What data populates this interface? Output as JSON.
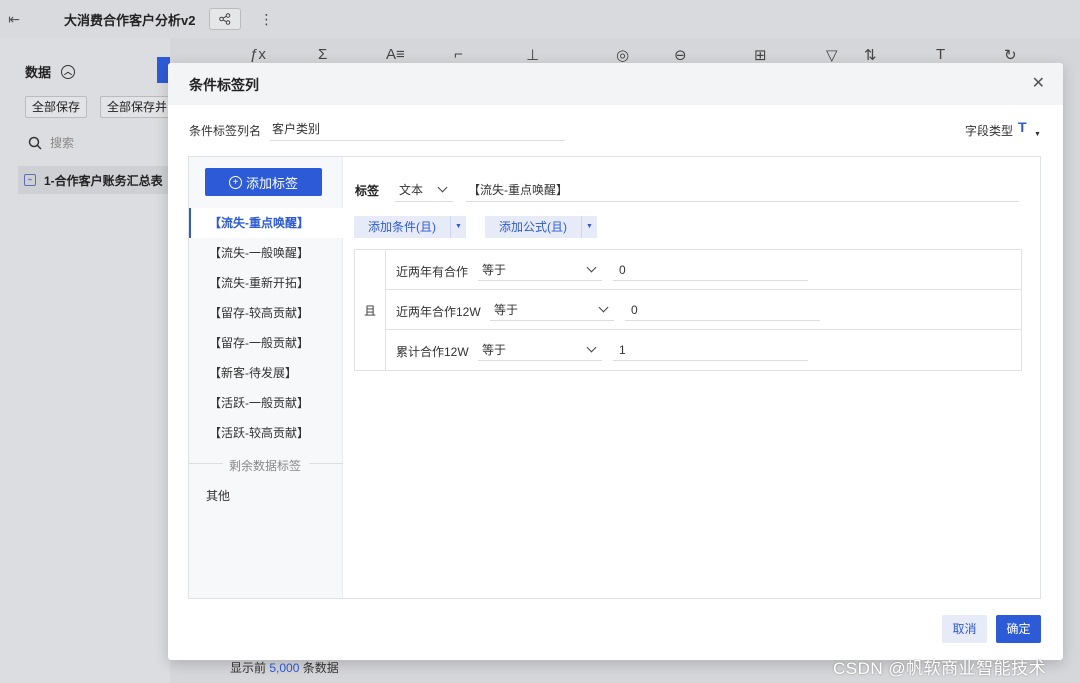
{
  "app": {
    "title": "大消费合作客户分析v2",
    "data_section": "数据",
    "save_all": "全部保存",
    "save_all_and": "全部保存并",
    "search_placeholder": "搜索",
    "table_name": "1-合作客户账务汇总表",
    "footer_prefix": "显示前",
    "footer_count": "5,000",
    "footer_suffix": "条数据"
  },
  "modal": {
    "title": "条件标签列",
    "name_label": "条件标签列名",
    "name_value": "客户类别",
    "field_type_label": "字段类型",
    "add_tag_label": "添加标签",
    "tags": [
      "【流失-重点唤醒】",
      "【流失-一般唤醒】",
      "【流失-重新开拓】",
      "【留存-较高贡献】",
      "【留存-一般贡献】",
      "【新客-待发展】",
      "【活跃-一般贡献】",
      "【活跃-较高贡献】"
    ],
    "remain_label": "剩余数据标签",
    "other_label": "其他",
    "tag_label": "标签",
    "tag_type": "文本",
    "tag_value": "【流失-重点唤醒】",
    "add_condition": "添加条件(且)",
    "add_formula": "添加公式(且)",
    "and_label": "且",
    "conditions": [
      {
        "field": "近两年有合作",
        "op": "等于",
        "value": "0"
      },
      {
        "field": "近两年合作12W",
        "op": "等于",
        "value": "0"
      },
      {
        "field": "累计合作12W",
        "op": "等于",
        "value": "1"
      }
    ],
    "cancel": "取消",
    "ok": "确定"
  },
  "watermark": "CSDN @帆软商业智能技术",
  "colors": {
    "primary": "#2d5bd7",
    "light": "#e7ebf7"
  }
}
